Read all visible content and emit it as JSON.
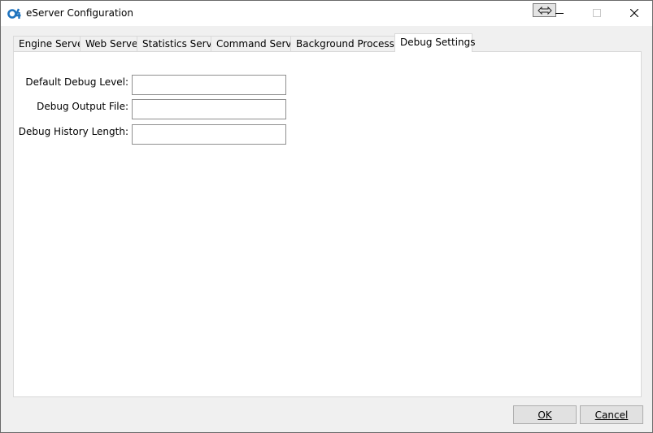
{
  "window": {
    "title": "eServer Configuration",
    "icon": "app-logo-icon",
    "controls": [
      "minimize-icon",
      "maximize-icon",
      "close-icon",
      "resize-arrows-icon"
    ]
  },
  "tabs": [
    {
      "label": "Engine Server",
      "active": false
    },
    {
      "label": "Web Server",
      "active": false
    },
    {
      "label": "Statistics Server",
      "active": false
    },
    {
      "label": "Command Server",
      "active": false
    },
    {
      "label": "Background Processes",
      "active": false
    },
    {
      "label": "Debug Settings",
      "active": true
    }
  ],
  "form": {
    "fields": [
      {
        "label": "Default Debug Level:",
        "value": ""
      },
      {
        "label": "Debug Output File:",
        "value": ""
      },
      {
        "label": "Debug History Length:",
        "value": ""
      }
    ]
  },
  "buttons": {
    "ok": "OK",
    "cancel": "Cancel"
  },
  "colors": {
    "logo_blue": "#1e73be",
    "window_bg": "#f0f0f0",
    "panel_bg": "#ffffff"
  }
}
